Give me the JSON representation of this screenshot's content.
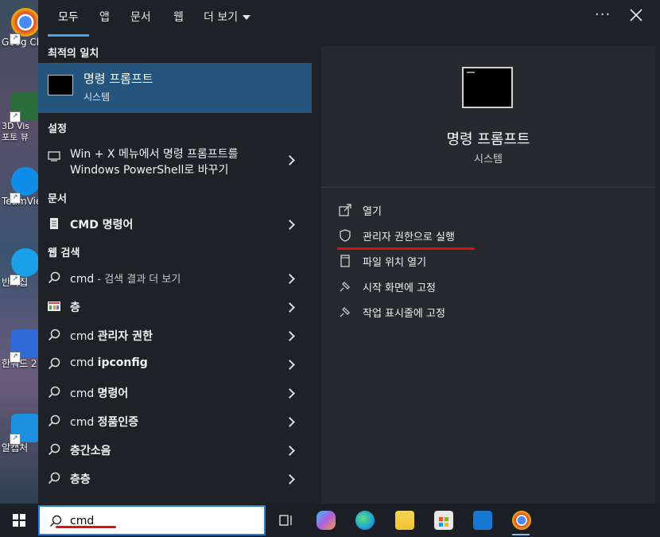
{
  "desktop": {
    "icons": [
      {
        "label": "Goog Chron",
        "name": "chrome-desktop-icon",
        "color": "#3a7de0"
      },
      {
        "label": "3D Vis 포토 뷰",
        "name": "3d-viewer-desktop-icon",
        "color": "#2a6c3a"
      },
      {
        "label": "TeamVie",
        "name": "teamviewer-desktop-icon",
        "color": "#0e8ee9"
      },
      {
        "label": "반디집",
        "name": "bandizip-desktop-icon",
        "color": "#1aa0e8"
      },
      {
        "label": "한워드 2",
        "name": "hanword-desktop-icon",
        "color": "#2f6bd6"
      },
      {
        "label": "알캡처",
        "name": "alcapture-desktop-icon",
        "color": "#1d8fe0"
      }
    ]
  },
  "tabs": [
    {
      "label": "모두",
      "active": true
    },
    {
      "label": "앱"
    },
    {
      "label": "문서"
    },
    {
      "label": "웹"
    },
    {
      "label": "더 보기"
    }
  ],
  "top": {
    "ellipsis": "···"
  },
  "left": {
    "best_match_header": "최적의 일치",
    "best_match": {
      "title": "명령 프롬프트",
      "subtitle": "시스템"
    },
    "settings_header": "설정",
    "settings_item_line1": "Win + X 메뉴에서 명령 프롬프트를",
    "settings_item_line2": "Windows PowerShell로 바꾸기",
    "docs_header": "문서",
    "docs_item": "CMD 명령어",
    "web_header": "웹 검색",
    "web_items": [
      {
        "plain": "cmd",
        "gray": " - 검색 결과 더 보기",
        "bold": ""
      },
      {
        "plain": "",
        "gray": "",
        "bold": "층"
      },
      {
        "plain": "cmd ",
        "gray": "",
        "bold": "관리자 권한"
      },
      {
        "plain": "cmd ",
        "gray": "",
        "bold": "ipconfig"
      },
      {
        "plain": "cmd ",
        "gray": "",
        "bold": "명령어"
      },
      {
        "plain": "cmd ",
        "gray": "",
        "bold": "정품인증"
      },
      {
        "plain": "",
        "gray": "",
        "bold": "층간소음"
      },
      {
        "plain": "",
        "gray": "",
        "bold": "층층"
      }
    ]
  },
  "preview": {
    "title": "명령 프롬프트",
    "subtitle": "시스템",
    "actions": [
      {
        "label": "열기",
        "icon": "open-icon"
      },
      {
        "label": "관리자 권한으로 실행",
        "icon": "shield-icon"
      },
      {
        "label": "파일 위치 열기",
        "icon": "file-location-icon"
      },
      {
        "label": "시작 화면에 고정",
        "icon": "pin-icon"
      },
      {
        "label": "작업 표시줄에 고정",
        "icon": "pin-icon"
      }
    ]
  },
  "taskbar": {
    "search_value": "cmd",
    "apps": [
      {
        "name": "task-view-icon",
        "color": "#d0d0d0"
      },
      {
        "name": "copilot-icon",
        "color": "#b05ce0"
      },
      {
        "name": "edge-icon",
        "color": "#1fa1d8"
      },
      {
        "name": "file-explorer-icon",
        "color": "#f2c230"
      },
      {
        "name": "store-icon",
        "color": "#e8e8e8"
      },
      {
        "name": "outlook-icon",
        "color": "#1778d2"
      },
      {
        "name": "chrome-icon",
        "color": "#e04a3a"
      }
    ]
  },
  "colors": {
    "accent": "#4aa3e8",
    "highlight": "#25547c",
    "annotation": "#e01010"
  }
}
